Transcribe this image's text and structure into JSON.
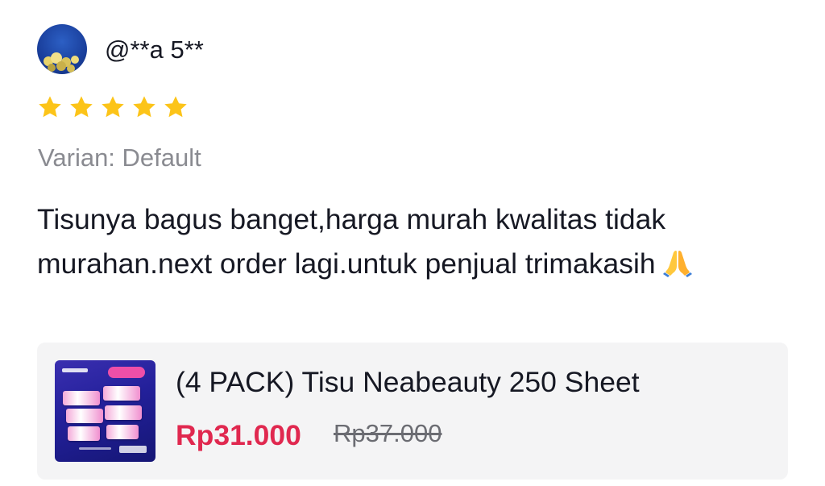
{
  "review": {
    "avatar_icon": "avatar-image",
    "username": "@**a 5**",
    "rating": 5,
    "rating_max": 5,
    "star_color": "#FCC419",
    "variant": "Varian: Default",
    "text": "Tisunya bagus banget,harga murah kwalitas tidak murahan.next order lagi.untuk penjual trimakasih",
    "emoji": "🙏"
  },
  "product": {
    "thumbnail_icon": "product-thumbnail",
    "title": "(4 PACK) Tisu Neabeauty 250 Sheet",
    "price": "Rp31.000",
    "original_price": "Rp37.000",
    "price_color": "#E0284F"
  }
}
